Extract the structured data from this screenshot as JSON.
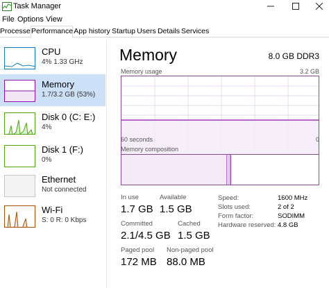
{
  "window": {
    "title": "Task Manager"
  },
  "menu": [
    "File",
    "Options",
    "View"
  ],
  "tabs": [
    {
      "label": "Processes",
      "active": false
    },
    {
      "label": "Performance",
      "active": true
    },
    {
      "label": "App history",
      "active": false
    },
    {
      "label": "Startup",
      "active": false
    },
    {
      "label": "Users",
      "active": false
    },
    {
      "label": "Details",
      "active": false
    },
    {
      "label": "Services",
      "active": false
    }
  ],
  "sidebar": [
    {
      "name": "CPU",
      "sub": "4%  1.33 GHz",
      "color": "#117dbb"
    },
    {
      "name": "Memory",
      "sub": "1.7/3.2 GB (53%)",
      "color": "#8b12ae",
      "selected": true
    },
    {
      "name": "Disk 0 (C: E:)",
      "sub": "4%",
      "color": "#4da60c"
    },
    {
      "name": "Disk 1 (F:)",
      "sub": "0%",
      "color": "#4da60c"
    },
    {
      "name": "Ethernet",
      "sub": "Not connected",
      "color": "#c8c8c8"
    },
    {
      "name": "Wi-Fi",
      "sub": "S: 0  R: 0 Kbps",
      "color": "#a74f01"
    }
  ],
  "main": {
    "title": "Memory",
    "spec": "8.0 GB DDR3",
    "usage_label": "Memory usage",
    "usage_max": "3.2 GB",
    "usage_level": 0.53,
    "time_left": "60 seconds",
    "time_right": "0",
    "composition_label": "Memory composition",
    "composition": {
      "in_use": 0.53,
      "modified": 0.02
    },
    "stats": [
      {
        "label": "In use",
        "value": "1.7 GB"
      },
      {
        "label": "Available",
        "value": "1.5 GB"
      },
      {
        "label": "Committed",
        "value": "2.1/4.5 GB"
      },
      {
        "label": "Cached",
        "value": "1.5 GB"
      },
      {
        "label": "Paged pool",
        "value": "172 MB"
      },
      {
        "label": "Non-paged pool",
        "value": "88.0 MB"
      }
    ],
    "details": [
      {
        "key": "Speed:",
        "value": "1600 MHz"
      },
      {
        "key": "Slots used:",
        "value": "2 of 2"
      },
      {
        "key": "Form factor:",
        "value": "SODIMM"
      },
      {
        "key": "Hardware reserved:",
        "value": "4.8 GB"
      }
    ]
  }
}
